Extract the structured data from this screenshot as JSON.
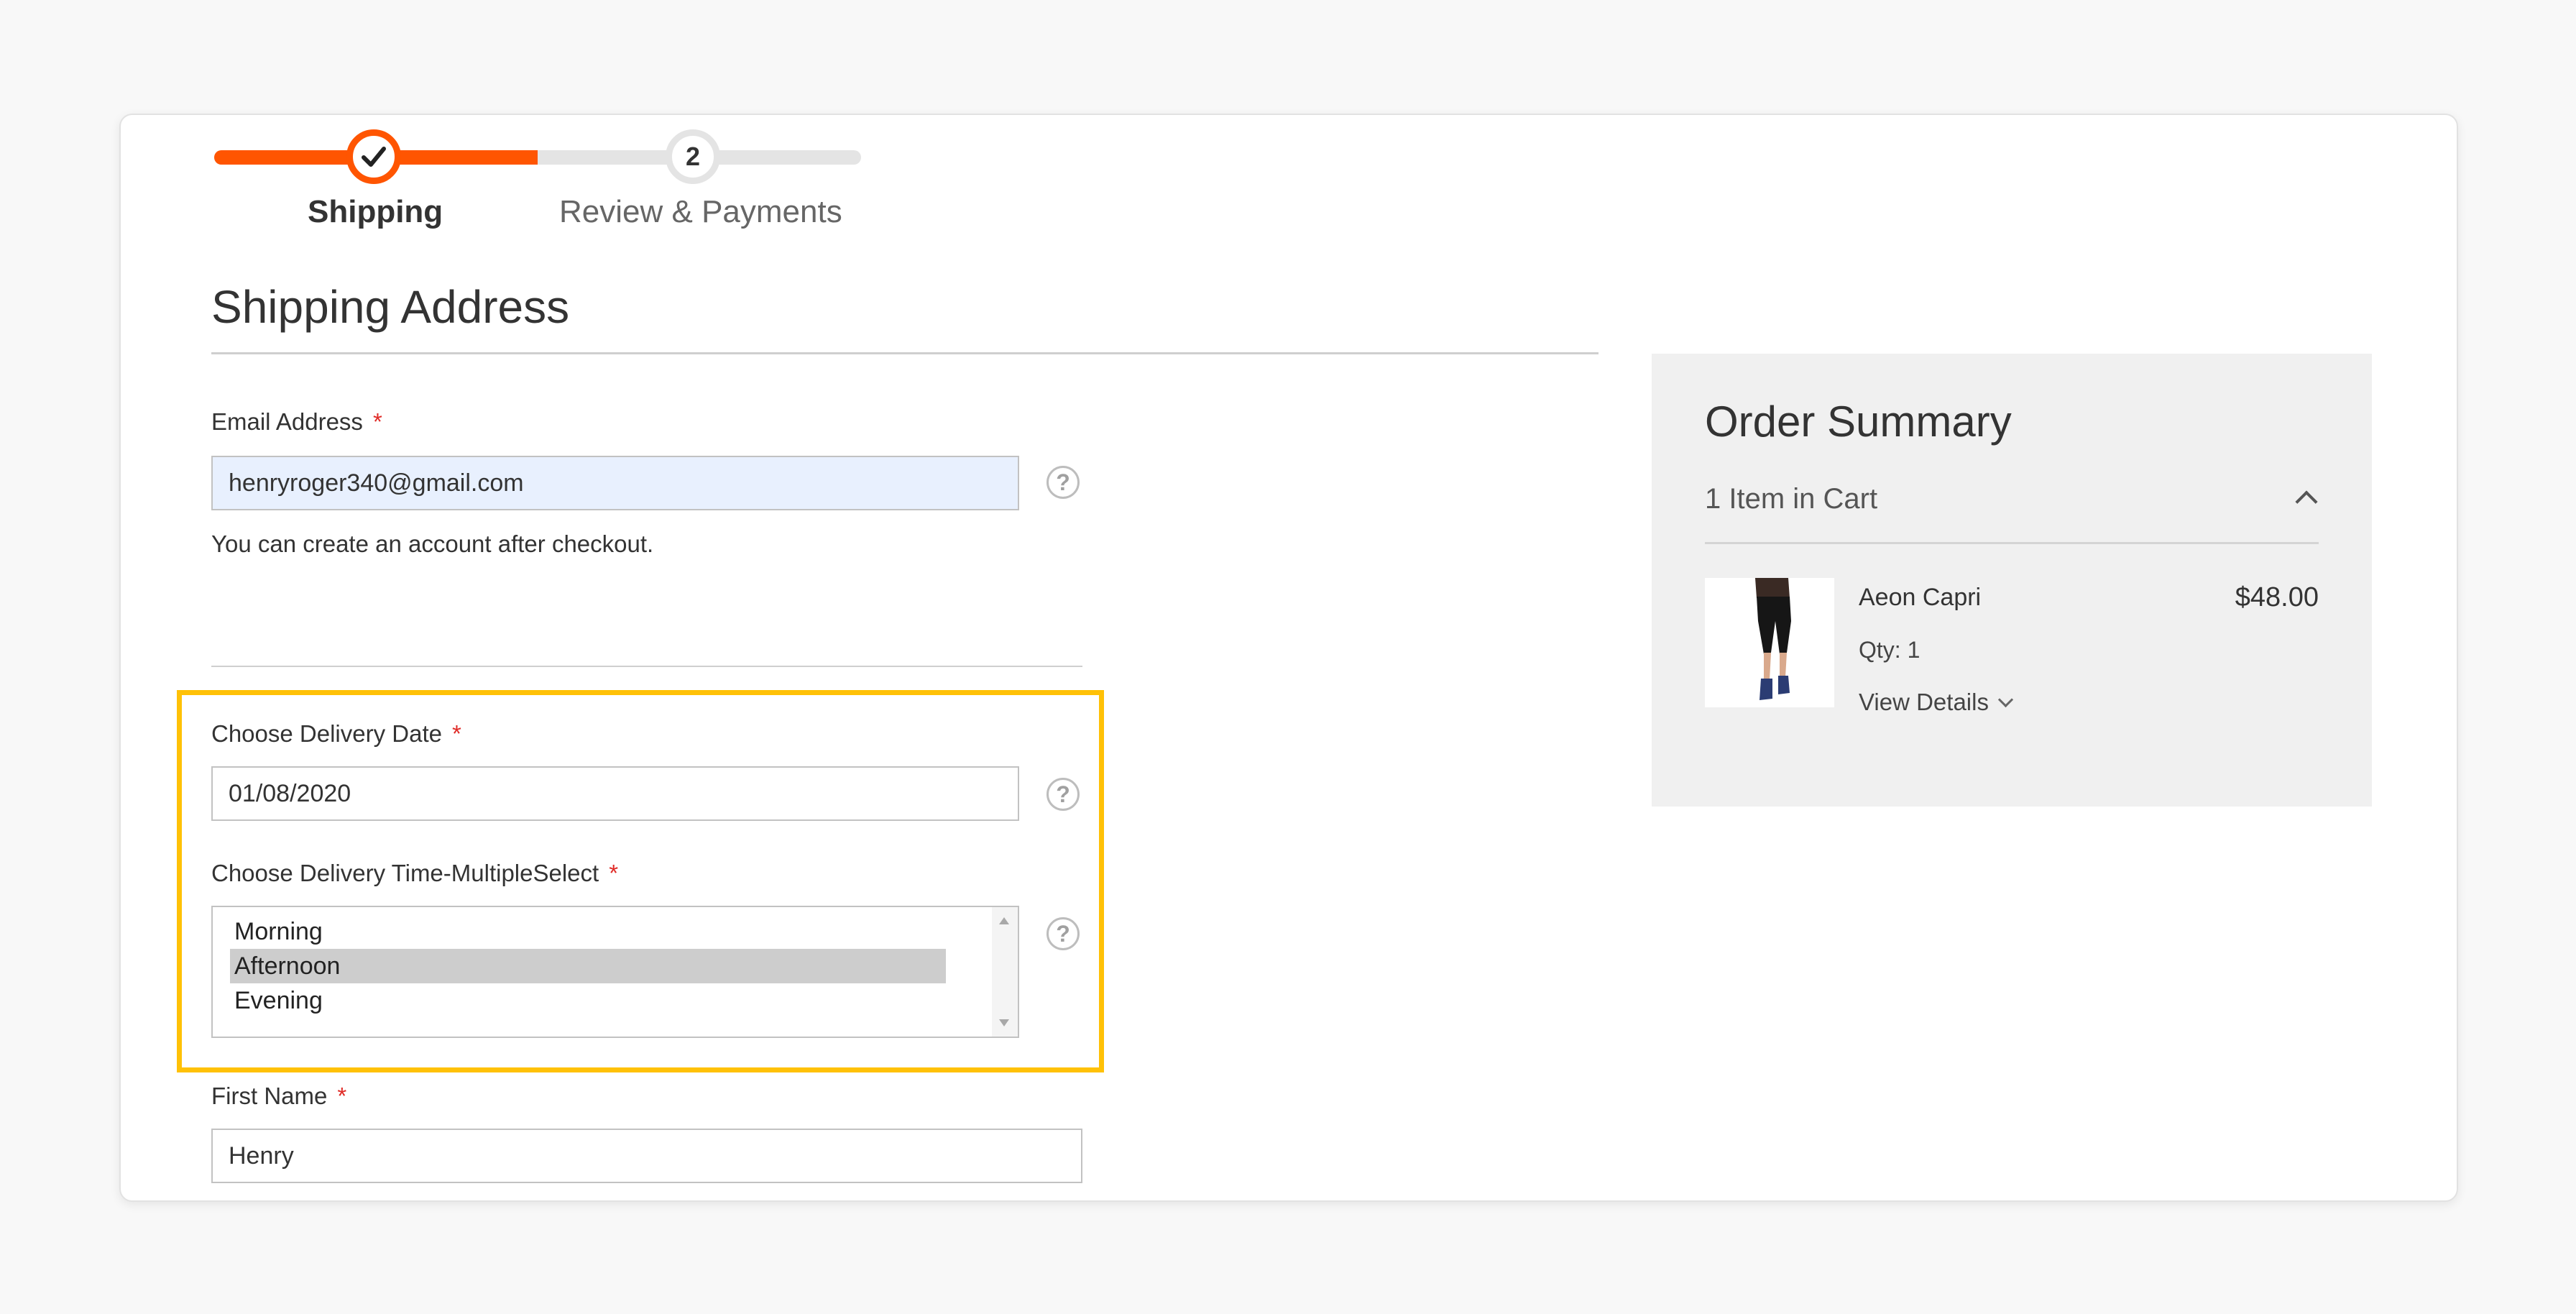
{
  "progress": {
    "steps": [
      {
        "number": "1",
        "label": "Shipping",
        "state": "complete"
      },
      {
        "number": "2",
        "label": "Review & Payments",
        "state": "upcoming"
      }
    ],
    "accent_color": "#ff5501"
  },
  "shipping": {
    "title": "Shipping Address",
    "email_label": "Email Address",
    "email_value": "henryroger340@gmail.com",
    "email_note": "You can create an account after checkout.",
    "required_mark": "*",
    "delivery_date_label": "Choose Delivery Date",
    "delivery_date_value": "01/08/2020",
    "delivery_time_label": "Choose Delivery Time-MultipleSelect",
    "delivery_time_options": [
      "Morning",
      "Afternoon",
      "Evening"
    ],
    "delivery_time_selected": "Afternoon",
    "first_name_label": "First Name",
    "first_name_value": "Henry",
    "help_glyph": "?"
  },
  "order_summary": {
    "title": "Order Summary",
    "items_in_cart": "1 Item in Cart",
    "product": {
      "name": "Aeon Capri",
      "price": "$48.00",
      "qty": "Qty: 1",
      "view_details": "View Details"
    }
  },
  "highlight_color": "#ffc107"
}
